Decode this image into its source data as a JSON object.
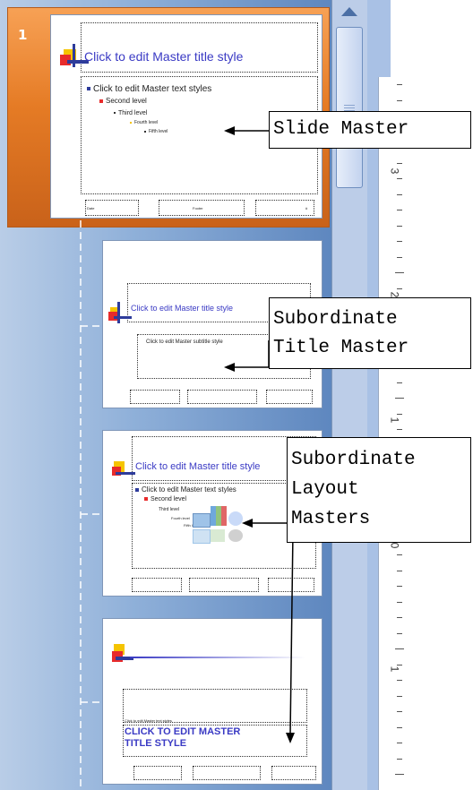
{
  "slide_panel": {
    "selected_slide_number": "1",
    "master": {
      "title": "Click to edit Master title style",
      "text_levels": [
        "Click to edit Master text styles",
        "Second level",
        "Third level",
        "Fourth level",
        "Fifth level"
      ],
      "footer": [
        "Date",
        "Footer",
        "#"
      ]
    },
    "title_layout": {
      "title": "Click to edit Master title style",
      "subtitle": "Click to edit Master subtitle style"
    },
    "content_layout": {
      "title": "Click to edit Master title style",
      "text_levels": [
        "Click to edit Master text styles",
        "Second level",
        "Third level",
        "Fourth level",
        "Fifth level"
      ]
    },
    "section_layout": {
      "small_text": "Click to edit Master text styles",
      "title": "CLICK TO EDIT MASTER TITLE STYLE"
    }
  },
  "ruler": {
    "labels": [
      "3",
      "2",
      "1",
      "0",
      "1"
    ]
  },
  "callouts": {
    "slide_master": "Slide Master",
    "title_master_line1": "Subordinate",
    "title_master_line2": "Title Master",
    "layout_line1": "Subordinate",
    "layout_line2": "Layout",
    "layout_line3": "Masters"
  },
  "colors": {
    "accent_orange": "#e57b25",
    "panel_blue": "#8fb0d9",
    "title_blue": "#3a3ac4"
  }
}
